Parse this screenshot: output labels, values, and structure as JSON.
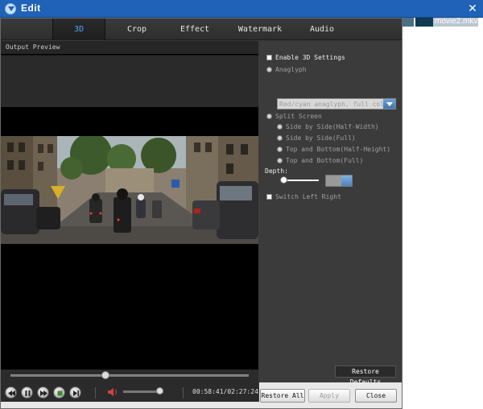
{
  "window": {
    "title": "Edit",
    "close_glyph": "✕"
  },
  "background_window": {
    "file_label": "movie2.mkv"
  },
  "tabs": [
    {
      "label": "3D",
      "active": true
    },
    {
      "label": "Crop",
      "active": false
    },
    {
      "label": "Effect",
      "active": false
    },
    {
      "label": "Watermark",
      "active": false
    },
    {
      "label": "Audio",
      "active": false
    }
  ],
  "preview": {
    "label": "Output Preview",
    "seek_position": 0.4,
    "volume_level": 0.9,
    "time_display": "00:58:41/02:27:24"
  },
  "settings": {
    "enable_3d": {
      "label": "Enable 3D Settings",
      "checked": false
    },
    "anaglyph": {
      "label": "Anaglyph",
      "selected": false
    },
    "anaglyph_mode": {
      "value": "Red/cyan anaglyph, full color"
    },
    "split_screen": {
      "label": "Split Screen",
      "selected": true
    },
    "split_options": [
      {
        "label": "Side by Side(Half-Width)"
      },
      {
        "label": "Side by Side(Full)"
      },
      {
        "label": "Top and Bottom(Half-Height)"
      },
      {
        "label": "Top and Bottom(Full)"
      }
    ],
    "depth": {
      "label": "Depth:",
      "value": ""
    },
    "switch_left_right": {
      "label": "Switch Left Right",
      "checked": false
    },
    "restore_defaults_label": "Restore Defaults"
  },
  "footer": {
    "restore_all": "Restore All",
    "apply": "Apply",
    "close": "Close"
  },
  "colors": {
    "titlebar": "#1f62b8",
    "active_tab_text": "#4aa8ff",
    "panel_bg": "#3b3b3b"
  }
}
